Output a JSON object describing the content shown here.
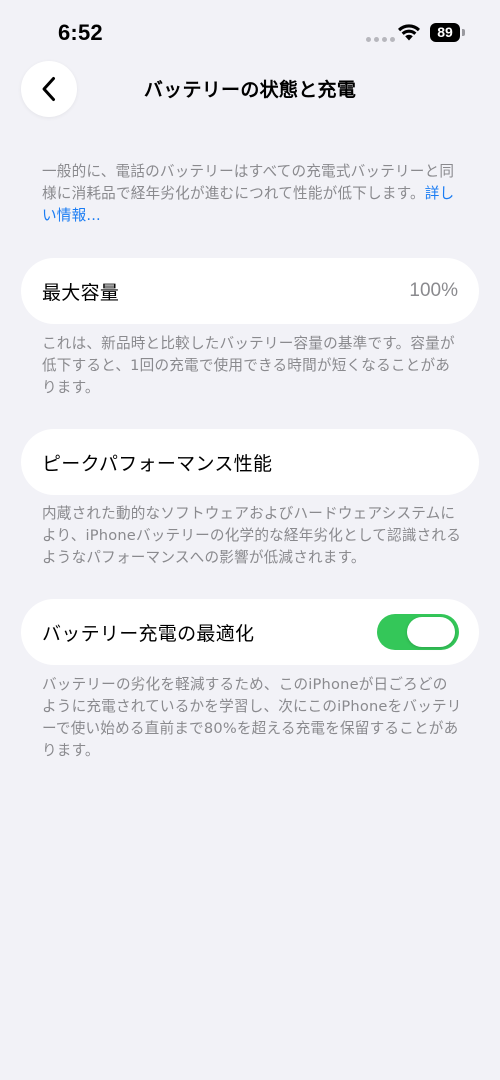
{
  "status_bar": {
    "time": "6:52",
    "battery_level": "89"
  },
  "nav": {
    "title": "バッテリーの状態と充電",
    "back_icon": "chevron-left-icon"
  },
  "intro": {
    "text": "一般的に、電話のバッテリーはすべての充電式バッテリーと同様に消耗品で経年劣化が進むにつれて性能が低下します。",
    "link": "詳しい情報..."
  },
  "max_capacity": {
    "label": "最大容量",
    "value": "100%",
    "note": "これは、新品時と比較したバッテリー容量の基準です。容量が低下すると、1回の充電で使用できる時間が短くなることがあります。"
  },
  "peak_performance": {
    "label": "ピークパフォーマンス性能",
    "note": "内蔵された動的なソフトウェアおよびハードウェアシステムにより、iPhoneバッテリーの化学的な経年劣化として認識されるようなパフォーマンスへの影響が低減されます。"
  },
  "optimized_charging": {
    "label": "バッテリー充電の最適化",
    "enabled": true,
    "note": "バッテリーの劣化を軽減するため、このiPhoneが日ごろどのように充電されているかを学習し、次にこのiPhoneをバッテリーで使い始める直前まで80%を超える充電を保留することがあります。"
  },
  "colors": {
    "background": "#f2f2f7",
    "card": "#ffffff",
    "secondary_text": "#8a8a8e",
    "link": "#1a7cf3",
    "toggle_on": "#34c759"
  }
}
